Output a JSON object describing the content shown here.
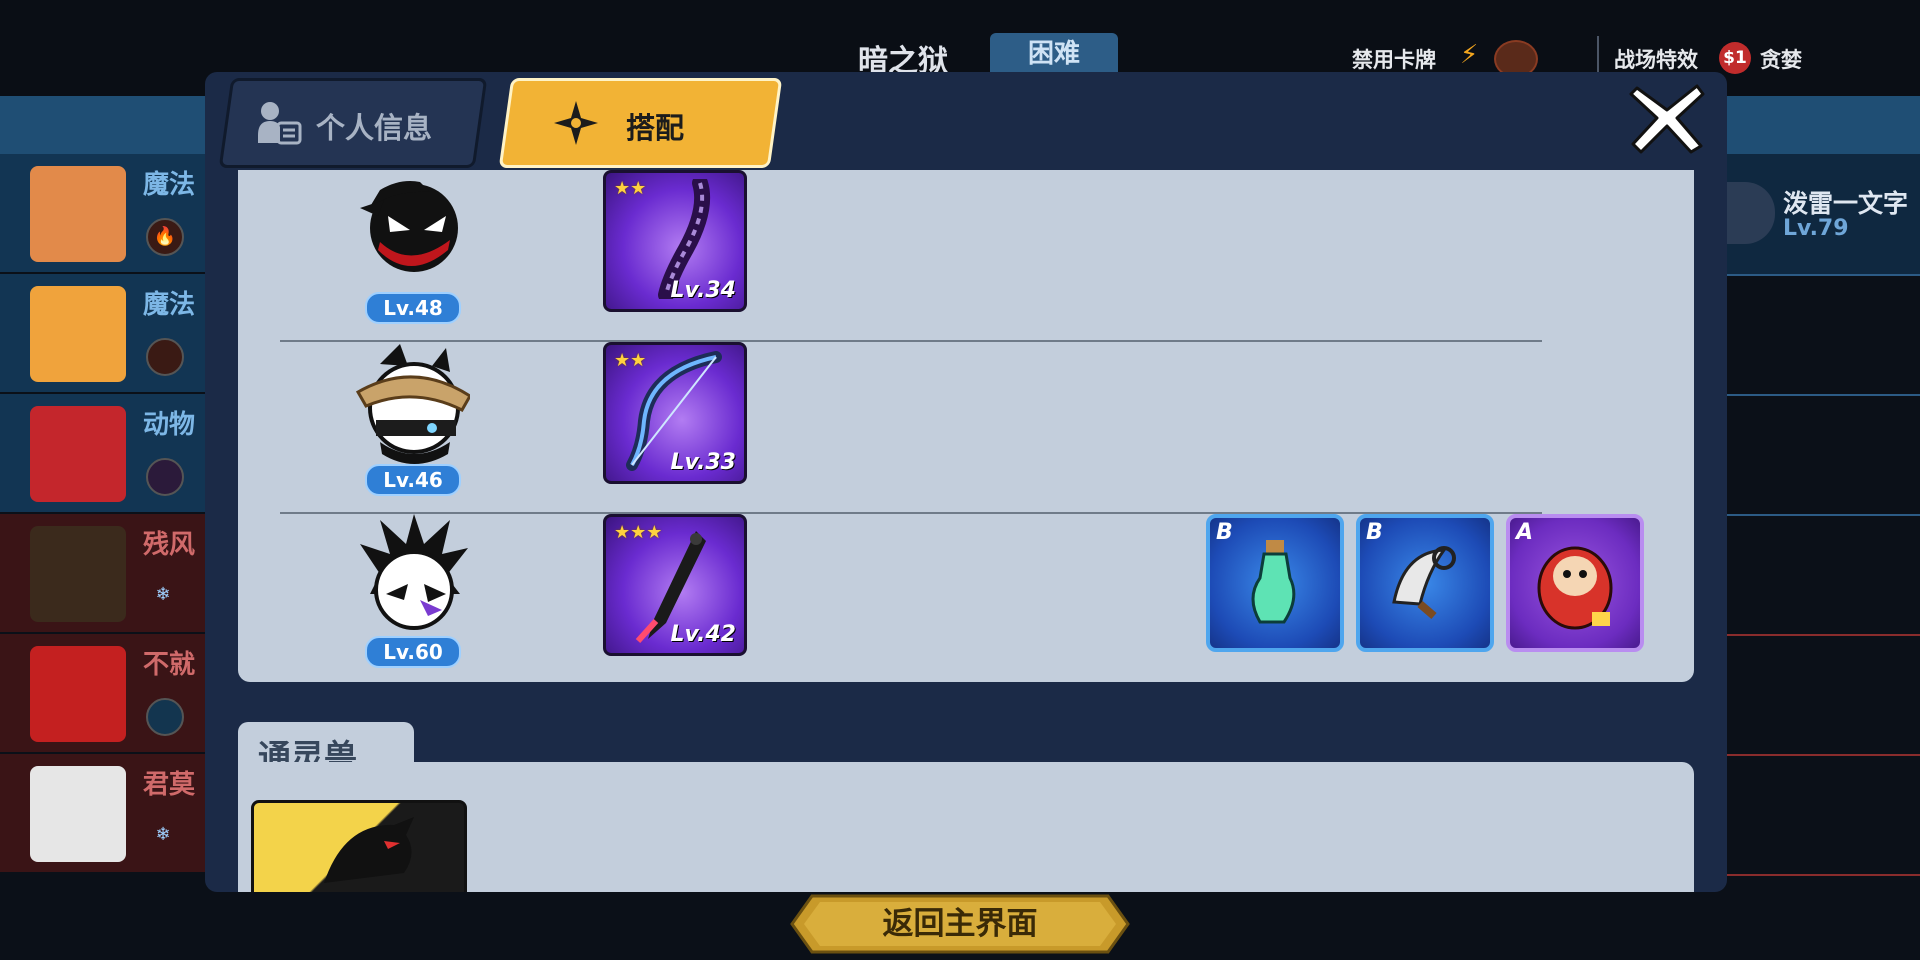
{
  "header": {
    "stage_title": "暗之狱",
    "difficulty": "困难",
    "banned_cards_label": "禁用卡牌",
    "battle_effect_label": "战场特效",
    "battle_effect_coin": "$1",
    "battle_effect_name": "贪婪"
  },
  "left_list": [
    {
      "label": "魔法",
      "theme": "blue"
    },
    {
      "label": "魔法",
      "theme": "blue"
    },
    {
      "label": "动物",
      "theme": "blue"
    },
    {
      "label": "残风",
      "theme": "red"
    },
    {
      "label": "不就",
      "theme": "red"
    },
    {
      "label": "君莫",
      "theme": "red"
    }
  ],
  "right_panel": {
    "name": "泼雷一文字",
    "level": "Lv.79"
  },
  "dialog": {
    "tabs": {
      "profile": "个人信息",
      "loadout": "搭配"
    },
    "loadout": [
      {
        "level": "Lv.48",
        "weapon_stars": "★★",
        "weapon_level": "Lv.34"
      },
      {
        "level": "Lv.46",
        "weapon_stars": "★★",
        "weapon_level": "Lv.33"
      },
      {
        "level": "Lv.60",
        "weapon_stars": "★★★",
        "weapon_level": "Lv.42",
        "items": [
          {
            "grade": "B"
          },
          {
            "grade": "B"
          },
          {
            "grade": "A"
          }
        ]
      }
    ],
    "spirit_beast_title": "通灵兽"
  },
  "footer": {
    "back_button": "返回主界面"
  },
  "colors": {
    "tab_active": "#f2b335",
    "panel": "#c3cedc",
    "dialog": "#1b2a47",
    "level_badge": "#2f7fd6"
  }
}
